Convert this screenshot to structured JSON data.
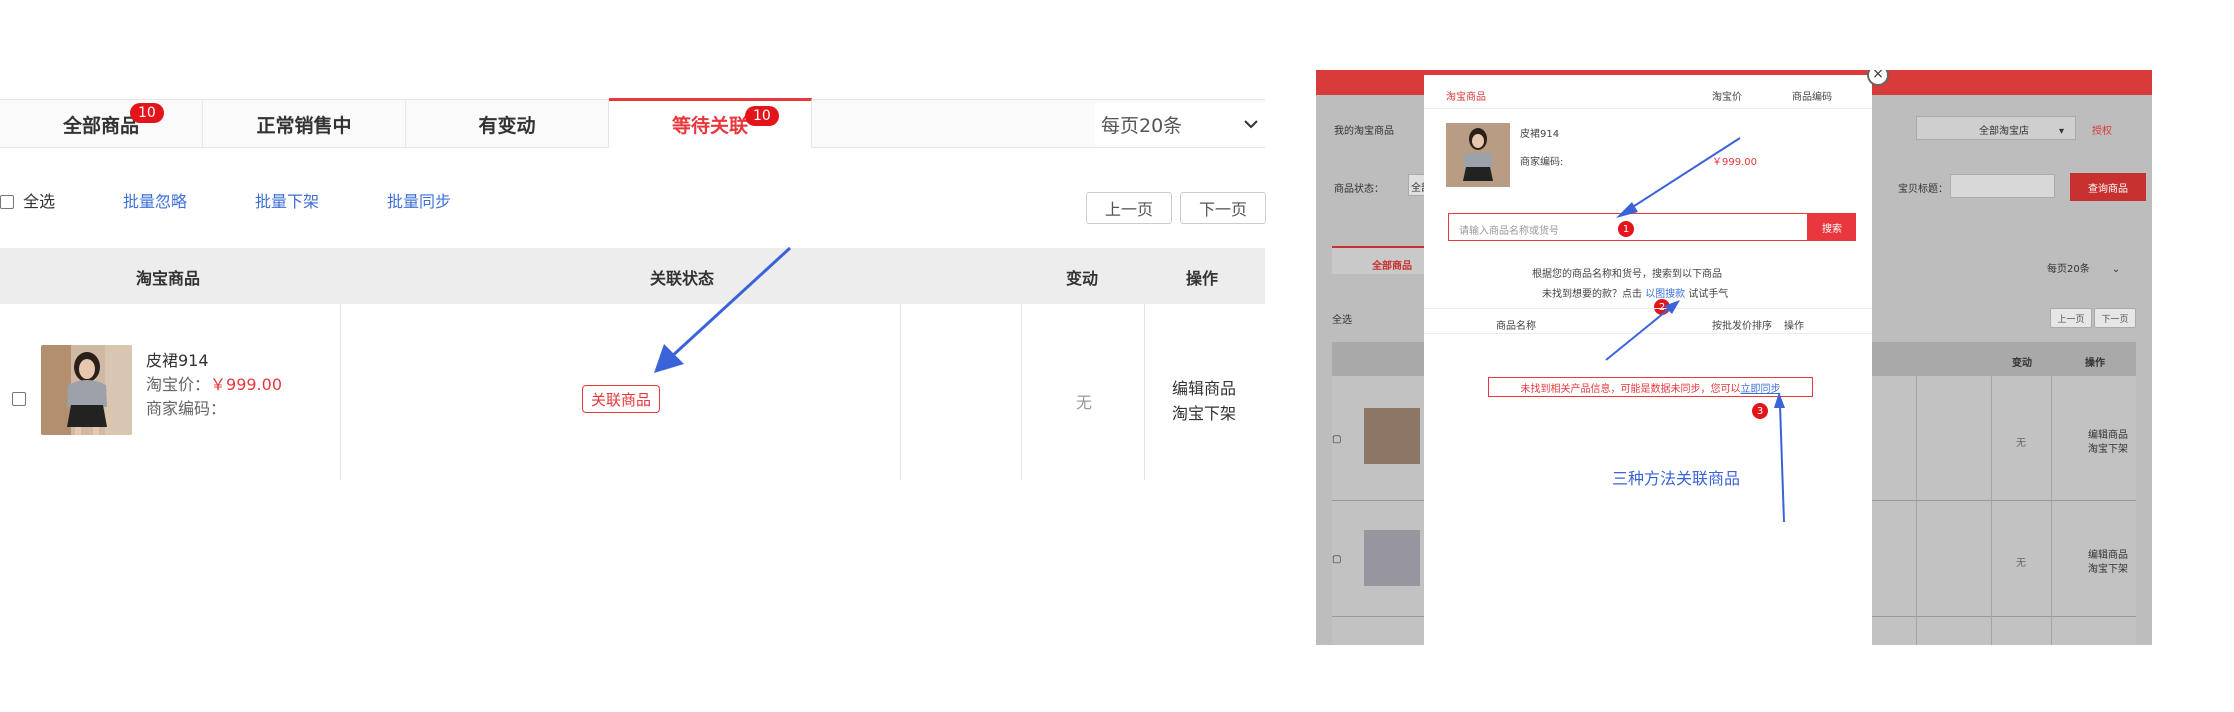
{
  "left": {
    "tabs": [
      {
        "label": "全部商品",
        "badge": "10"
      },
      {
        "label": "正常销售中",
        "badge": ""
      },
      {
        "label": "有变动",
        "badge": ""
      },
      {
        "label": "等待关联",
        "badge": "10"
      }
    ],
    "per_page": "每页20条",
    "select_all": "全选",
    "batch_ignore": "批量忽略",
    "batch_offshelf": "批量下架",
    "batch_sync": "批量同步",
    "prev_page": "上一页",
    "next_page": "下一页",
    "headers": {
      "taobao_product": "淘宝商品",
      "link_status": "关联状态",
      "change": "变动",
      "action": "操作"
    },
    "row": {
      "name": "皮裙914",
      "price_label": "淘宝价：",
      "price": "￥999.00",
      "merchant_code_label": "商家编码：",
      "link_tag": "关联商品",
      "change": "无",
      "edit": "编辑商品",
      "offshelf": "淘宝下架"
    },
    "colors": {
      "accent": "#e8383d",
      "link": "#3e6fd8",
      "arrow": "#3a63d9"
    }
  },
  "right": {
    "bg": {
      "my_taobao": "我的淘宝商品",
      "status_label": "商品状态：",
      "status_value": "全部",
      "filter_select": "全部淘宝店",
      "filter_link": "授权",
      "title_label": "宝贝标题：",
      "query_button": "查询商品",
      "tab_all": "全部商品",
      "per_page": "每页20条",
      "select_all": "全选",
      "prev": "上一页",
      "next": "下一页",
      "col_change": "变动",
      "col_action": "操作",
      "rows": [
        {
          "change": "无",
          "edit": "编辑商品",
          "offshelf": "淘宝下架"
        },
        {
          "change": "无",
          "edit": "编辑商品",
          "offshelf": "淘宝下架"
        }
      ]
    },
    "modal": {
      "col_taobao": "淘宝商品",
      "col_price": "淘宝价",
      "col_code": "商品编码",
      "product_name": "皮裙914",
      "merchant_code": "商家编码:",
      "price": "￥999.00",
      "search_placeholder": "请输入商品名称或货号",
      "search_button": "搜索",
      "hint1": "根据您的商品名称和货号，搜索到以下商品",
      "hint2_prefix": "未找到想要的款？点击",
      "hint2_link": "以图搜款",
      "hint2_suffix": "试试手气",
      "list_col_name": "商品名称",
      "list_col_sort": "按批发价排序",
      "list_col_action": "操作",
      "notice_prefix": "未找到相关产品信息，可能是数据未同步，您可以",
      "notice_link": "立即同步",
      "step1": "1",
      "step2": "2",
      "step3": "3",
      "caption": "三种方法关联商品"
    }
  }
}
